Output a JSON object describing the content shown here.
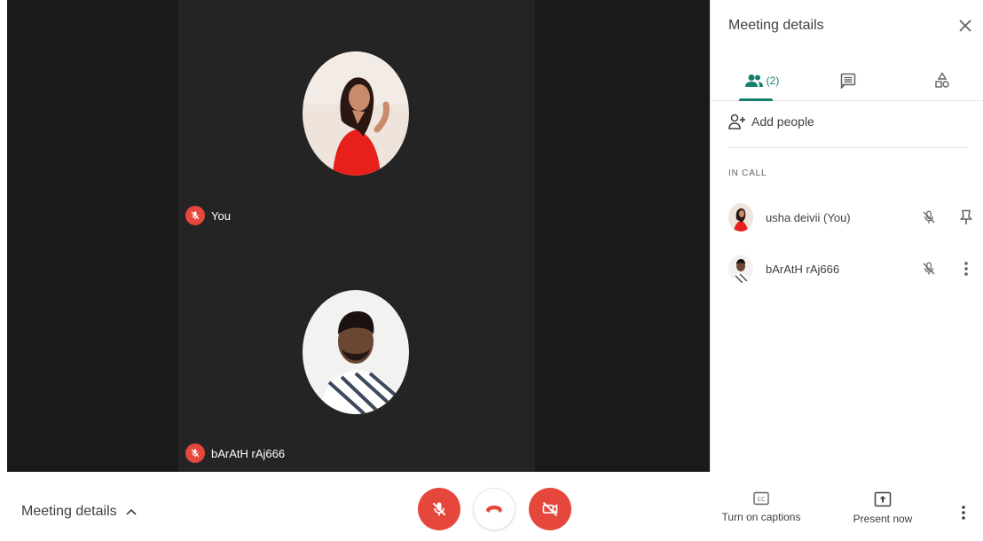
{
  "stage": {
    "tiles": [
      {
        "name": "You",
        "muted": true,
        "avatar": "woman-red-dress-photo"
      },
      {
        "name": "bArAtH rAj666",
        "muted": true,
        "avatar": "man-striped-shirt-photo"
      }
    ]
  },
  "panel": {
    "title": "Meeting details",
    "close_icon": "close-icon",
    "tabs": [
      {
        "icon": "people-icon",
        "count": "(2)",
        "selected": true
      },
      {
        "icon": "chat-icon",
        "selected": false
      },
      {
        "icon": "activities-icon",
        "selected": false
      }
    ],
    "add_people": "Add people",
    "section_label": "IN CALL",
    "participants": [
      {
        "name": "usha deivii (You)",
        "mic_icon": "mic-off-icon",
        "action_icon": "pin-icon"
      },
      {
        "name": "bArAtH rAj666",
        "mic_icon": "mic-off-icon",
        "action_icon": "more-vert-icon"
      }
    ]
  },
  "bottombar": {
    "meeting_details": "Meeting details",
    "captions_label": "Turn on captions",
    "present_label": "Present now"
  },
  "colors": {
    "accent": "#137f6c",
    "danger": "#e5473c",
    "stage_bg": "#1a1a1a",
    "tile_bg": "#242424"
  }
}
